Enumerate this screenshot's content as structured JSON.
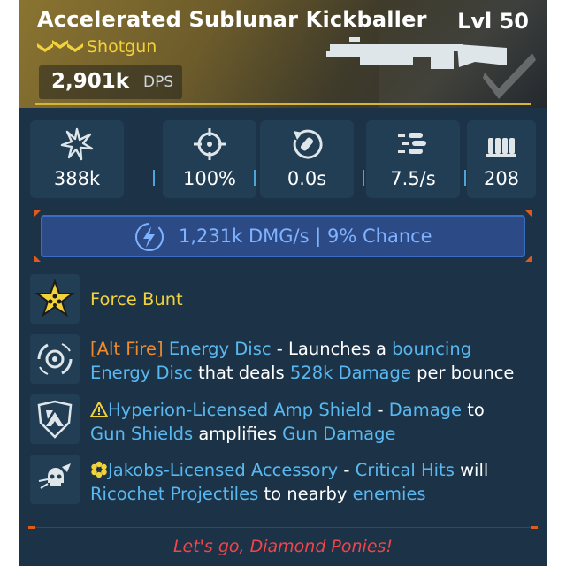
{
  "item": {
    "name": "Accelerated Sublunar Kickballer",
    "level": "Lvl 50",
    "type": "Shotgun",
    "rarity": "legendary",
    "dps_value": "2,901k",
    "dps_label": "DPS"
  },
  "colors": {
    "legendary_gold": "#f2d23a",
    "stat_blue": "#59b8f0",
    "alt_fire_orange": "#f08a2a",
    "flavor_red": "#f0464a",
    "card_bg": "#1b3247"
  },
  "stats": [
    {
      "icon": "damage-icon",
      "value": "388k"
    },
    {
      "icon": "accuracy-icon",
      "value": "100%"
    },
    {
      "icon": "reload-icon",
      "value": "0.0s"
    },
    {
      "icon": "fire-rate-icon",
      "value": "7.5/s"
    },
    {
      "icon": "magazine-icon",
      "value": "208"
    }
  ],
  "elemental": {
    "icon": "shock-bolt-icon",
    "dmg": "1,231k DMG/s",
    "separator": "|",
    "chance": "9% Chance"
  },
  "perks": [
    {
      "icon": "force-bunt-star-icon",
      "title": "Force Bunt"
    },
    {
      "icon": "energy-disc-icon",
      "alt_fire": "[Alt Fire]",
      "name": "Energy Disc",
      "dash": " - ",
      "t1": "Launches a ",
      "k1": "bouncing",
      "k2": "Energy Disc",
      "t2": " that deals ",
      "k3": "528k Damage",
      "t3": " per bounce"
    },
    {
      "icon": "hyperion-amp-shield-icon",
      "name": "Hyperion-Licensed Amp Shield",
      "dash": " - ",
      "k1": "Damage",
      "t1": " to",
      "k2": "Gun Shields",
      "t2": " amplifies ",
      "k3": "Gun Damage"
    },
    {
      "icon": "jakobs-accessory-icon",
      "name": "Jakobs-Licensed Accessory",
      "dash": " - ",
      "k1": "Critical Hits",
      "t1": " will",
      "k2": "Ricochet Projectiles",
      "t2": " to nearby ",
      "k3": "enemies"
    }
  ],
  "flavor_text": "Let's go, Diamond Ponies!"
}
